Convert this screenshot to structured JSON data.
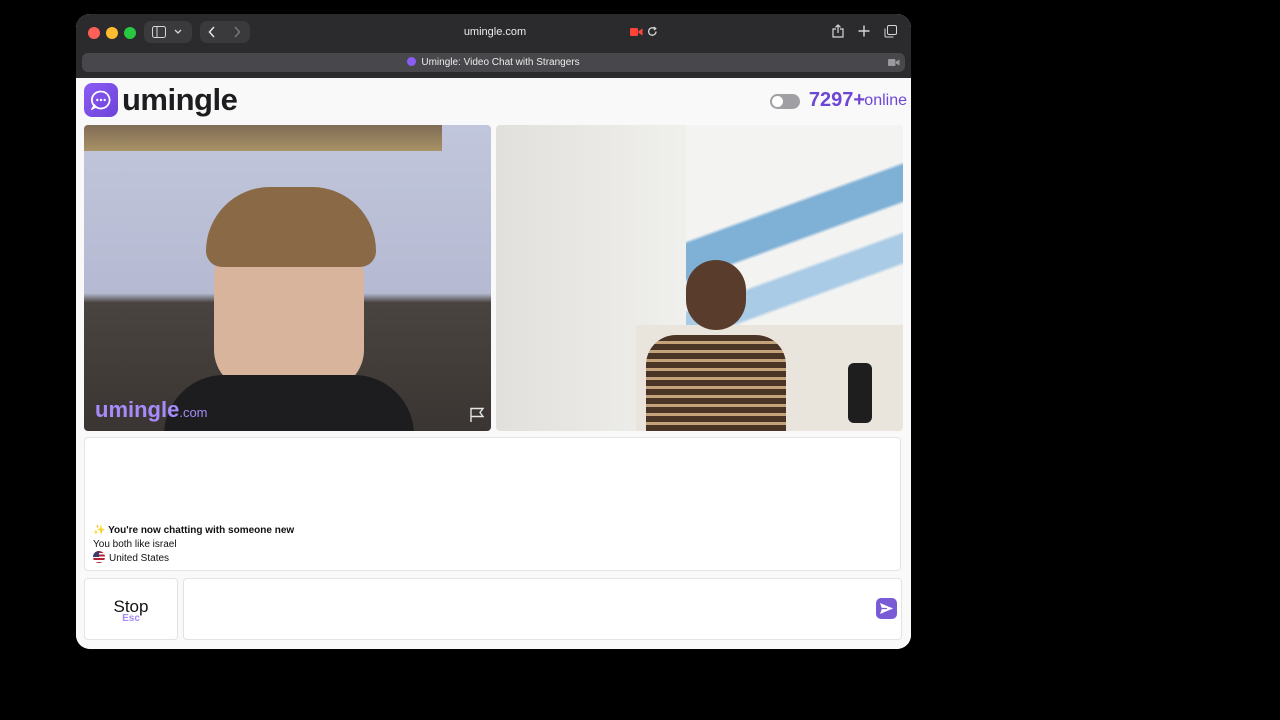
{
  "browser": {
    "url": "umingle.com",
    "tab_title": "Umingle: Video Chat with Strangers"
  },
  "header": {
    "logo_text": "umingle",
    "online_count": "7297+",
    "online_label": "online"
  },
  "video": {
    "watermark_brand": "umingle",
    "watermark_domain": ".com"
  },
  "chat": {
    "status_emoji": "✨",
    "status_message": "You're now chatting with someone new",
    "common_interest": "You both like israel",
    "country": "United States"
  },
  "controls": {
    "stop_label": "Stop",
    "stop_shortcut": "Esc",
    "message_placeholder": ""
  },
  "colors": {
    "brand": "#7a5bd6",
    "online_text": "#6e46d6"
  }
}
